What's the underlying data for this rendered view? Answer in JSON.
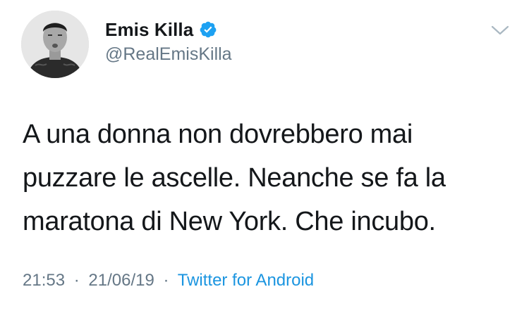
{
  "user": {
    "display_name": "Emis Killa",
    "handle": "@RealEmisKilla",
    "verified": true,
    "avatar_icon": "profile-photo"
  },
  "tweet": {
    "lines": [
      "A una donna non dovrebbero mai",
      "puzzare le ascelle. Neanche se fa la",
      "maratona di New York. Che incubo."
    ]
  },
  "meta": {
    "time": "21:53",
    "separator": "·",
    "date": "21/06/19",
    "source": "Twitter for Android"
  },
  "colors": {
    "text": "#14171a",
    "secondary": "#657786",
    "link": "#1b95e0",
    "verified": "#1da1f2"
  },
  "icons": {
    "verified": "verified-badge-icon",
    "menu": "chevron-down-icon"
  }
}
